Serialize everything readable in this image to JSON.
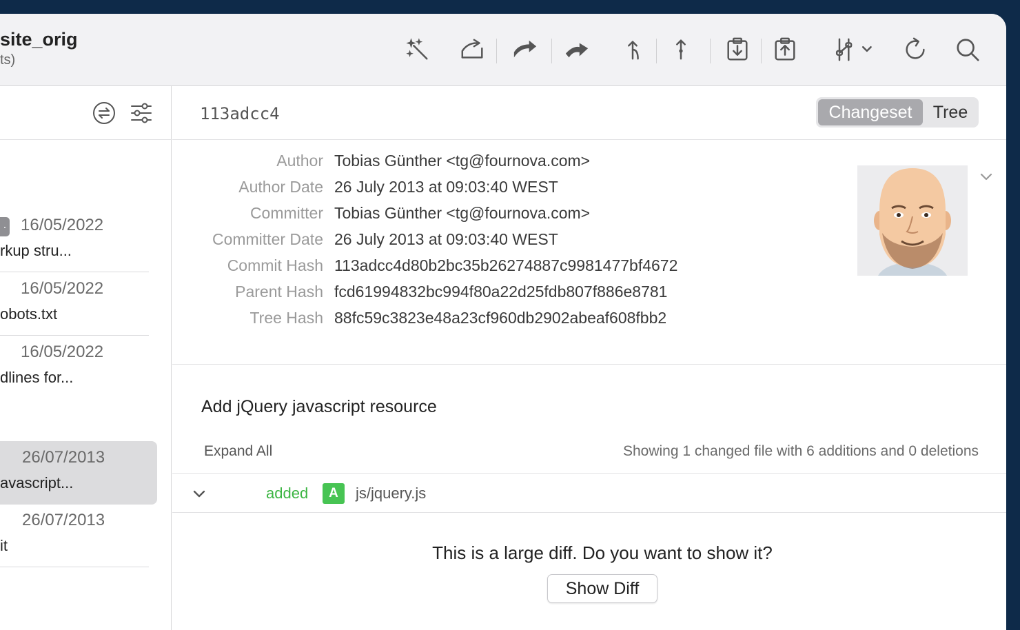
{
  "window": {
    "title": "site_orig",
    "subtitle": "ts)"
  },
  "toolbar": {
    "icons": [
      "magic-wand-icon",
      "fetch-icon",
      "pull-icon",
      "push-icon",
      "merge-icon",
      "rebase-icon",
      "stash-icon",
      "pop-stash-icon",
      "view-options-icon",
      "refresh-icon",
      "search-icon"
    ]
  },
  "sidebar": {
    "commits": [
      {
        "tag": ".",
        "date": "16/05/2022",
        "message": "rkup stru..."
      },
      {
        "date": "16/05/2022",
        "message": "obots.txt"
      },
      {
        "date": "16/05/2022",
        "message": "dlines for..."
      },
      {
        "date": "26/07/2013",
        "message": "avascript...",
        "selected": true
      },
      {
        "date": "26/07/2013",
        "message": "it"
      }
    ]
  },
  "commit": {
    "short_hash": "113adcc4",
    "view_tabs": {
      "changeset": "Changeset",
      "tree": "Tree",
      "active": "Changeset"
    },
    "fields": [
      {
        "label": "Author",
        "value": "Tobias Günther <tg@fournova.com>"
      },
      {
        "label": "Author Date",
        "value": "26 July 2013 at 09:03:40 WEST"
      },
      {
        "label": "Committer",
        "value": "Tobias Günther <tg@fournova.com>"
      },
      {
        "label": "Committer Date",
        "value": "26 July 2013 at 09:03:40 WEST"
      },
      {
        "label": "Commit Hash",
        "value": "113adcc4d80b2bc35b26274887c9981477bf4672"
      },
      {
        "label": "Parent Hash",
        "value": "fcd61994832bc994f80a22d25fdb807f886e8781"
      },
      {
        "label": "Tree Hash",
        "value": "88fc59c3823e48a23cf960db2902abeaf608fbb2"
      }
    ],
    "subject": "Add jQuery javascript resource",
    "expand_all": "Expand All",
    "summary": "Showing 1 changed file with 6 additions and 0 deletions",
    "files": [
      {
        "status": "added",
        "badge": "A",
        "path": "js/jquery.js"
      }
    ],
    "large_diff_message": "This is a large diff. Do you want to show it?",
    "show_diff_label": "Show Diff"
  },
  "colors": {
    "background": "#0e2a49",
    "added": "#47c453",
    "segment_active": "#a9a9ad"
  }
}
